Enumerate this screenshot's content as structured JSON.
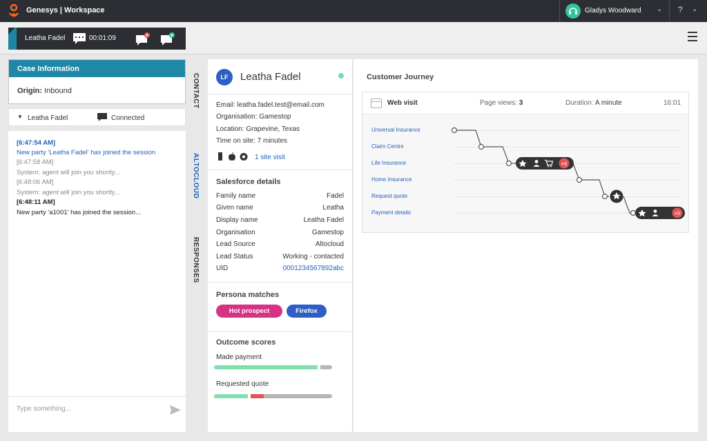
{
  "topbar": {
    "app_title": "Genesys | Workspace",
    "user_name": "Gladys Woodward",
    "help": "?"
  },
  "interaction": {
    "customer_name": "Leatha Fadel",
    "timer": "00:01:09"
  },
  "case": {
    "header": "Case Information",
    "origin_label": "Origin:",
    "origin_value": "Inbound"
  },
  "party": {
    "name": "Leatha Fadel",
    "status": "Connected"
  },
  "transcript": [
    {
      "time": "[6:47:54 AM]",
      "text": "New party 'Leatha Fadel' has joined the session"
    },
    {
      "time": "[6:47:58 AM]",
      "text": "System: agent will join you shortly..."
    },
    {
      "time": "[6:48:06 AM]",
      "text": "System: agent will join you shortly..."
    },
    {
      "time": "[6:48:11 AM]",
      "text": "New party 'a1001' has joined the session..."
    }
  ],
  "composer": {
    "placeholder": "Type something..."
  },
  "vertical_tabs": {
    "contact": "CONTACT",
    "altocloud": "ALTOCLOUD",
    "responses": "RESPONSES"
  },
  "contact": {
    "initials": "LF",
    "name": "Leatha Fadel",
    "email": "Email: leatha.fadel.test@email.com",
    "organisation": "Organisation: Gamestop",
    "location": "Location: Grapevine, Texas",
    "time_on_site": "Time on site: 7 minutes",
    "site_visit": "1 site visit"
  },
  "salesforce": {
    "title": "Salesforce details",
    "rows": [
      {
        "label": "Family name",
        "value": "Fadel"
      },
      {
        "label": "Given name",
        "value": "Leatha"
      },
      {
        "label": "Display name",
        "value": "Leatha Fadel"
      },
      {
        "label": "Organisation",
        "value": "Gamestop"
      },
      {
        "label": "Lead Source",
        "value": "Altocloud"
      },
      {
        "label": "Lead Status",
        "value": "Working - contacted"
      },
      {
        "label": "UID",
        "value": "0001234567892abc"
      }
    ]
  },
  "persona": {
    "title": "Persona matches",
    "pills": [
      "Hot prospect",
      "Firefox"
    ]
  },
  "outcomes": {
    "title": "Outcome scores",
    "items": [
      {
        "label": "Made payment",
        "value": 0.88
      },
      {
        "label": "Requested quote",
        "value": 0.3
      }
    ]
  },
  "journey": {
    "title": "Customer Journey",
    "visit_type": "Web visit",
    "page_views_label": "Page views:",
    "page_views": "3",
    "duration_label": "Duration:",
    "duration": "A minute",
    "time": "16:01",
    "pages": [
      "Universal Insurance",
      "Claim Centre",
      "Life Insurance",
      "Home Insurance",
      "Request quote",
      "Payment details"
    ],
    "badge_1_count": "+6",
    "badge_2_count": "+5"
  },
  "colors": {
    "accent": "#1f88a6",
    "link": "#1f63b5",
    "pink": "#d63384",
    "blue": "#2d5fc5",
    "green": "#80e0b0",
    "red": "#e05555"
  }
}
